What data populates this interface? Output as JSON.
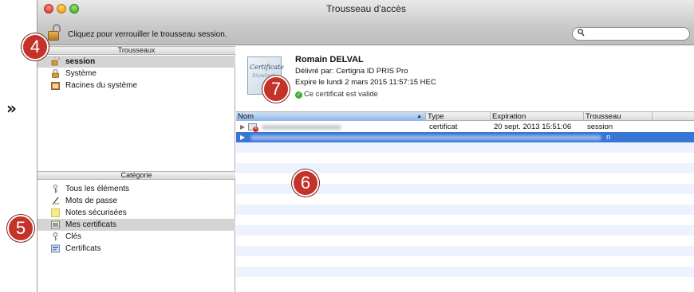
{
  "page_marker": "»",
  "window": {
    "title": "Trousseau d'accès",
    "lock_text": "Cliquez pour verrouiller le trousseau session.",
    "search_placeholder": ""
  },
  "sidebar": {
    "keychains_header": "Trousseaux",
    "keychains": [
      {
        "label": "session",
        "selected": true,
        "icon": "keychain-unlocked-icon"
      },
      {
        "label": "Système",
        "selected": false,
        "icon": "lock-icon"
      },
      {
        "label": "Racines du système",
        "selected": false,
        "icon": "folder-icon"
      }
    ],
    "category_header": "Catégorie",
    "categories": [
      {
        "label": "Tous les éléments",
        "selected": false,
        "icon": "all-items-icon"
      },
      {
        "label": "Mots de passe",
        "selected": false,
        "icon": "password-icon"
      },
      {
        "label": "Notes sécurisées",
        "selected": false,
        "icon": "secure-note-icon"
      },
      {
        "label": "Mes certificats",
        "selected": true,
        "icon": "my-certificate-icon"
      },
      {
        "label": "Clés",
        "selected": false,
        "icon": "key-icon"
      },
      {
        "label": "Certificats",
        "selected": false,
        "icon": "certificate-icon"
      }
    ]
  },
  "certificate": {
    "image_text": "Certificate",
    "image_subtext": "Standard",
    "name": "Romain DELVAL",
    "issued_by": "Délivré par: Certigna ID PRIS Pro",
    "expires": "Expire le lundi 2 mars 2015 11:57:15 HEC",
    "status": "Ce certificat est valide",
    "status_color": "#3dac2e"
  },
  "table": {
    "columns": [
      "Nom",
      "Type",
      "Expiration",
      "Trousseau"
    ],
    "rows": [
      {
        "name": "",
        "type": "certificat",
        "expiration": "20 sept. 2013 15:51:06",
        "keychain": "session"
      },
      {
        "name": "",
        "type": "",
        "expiration": "",
        "keychain": "n"
      }
    ]
  },
  "callouts": [
    "4",
    "5",
    "6",
    "7"
  ],
  "colors": {
    "selection": "#3876d6",
    "callout": "#c3332a"
  }
}
